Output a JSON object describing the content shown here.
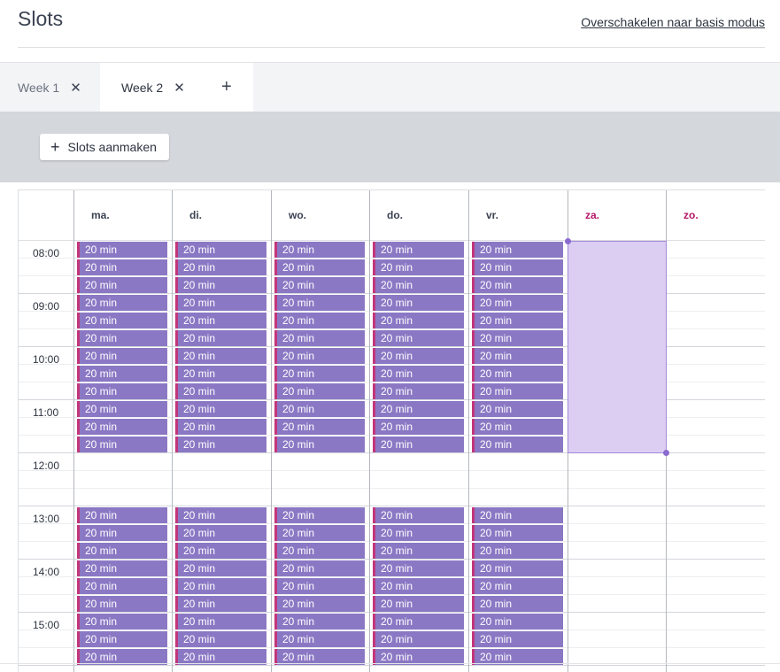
{
  "header": {
    "title": "Slots",
    "mode_link": "Overschakelen naar basis modus"
  },
  "tabs": [
    {
      "label": "Week 1",
      "closable": true,
      "active": false
    },
    {
      "label": "Week 2",
      "closable": true,
      "active": true
    }
  ],
  "tab_add_icon": "plus-icon",
  "toolbar": {
    "create_label": "Slots aanmaken",
    "create_icon": "plus-icon"
  },
  "calendar": {
    "days": [
      {
        "label": "ma.",
        "weekend": false
      },
      {
        "label": "di.",
        "weekend": false
      },
      {
        "label": "wo.",
        "weekend": false
      },
      {
        "label": "do.",
        "weekend": false
      },
      {
        "label": "vr.",
        "weekend": false
      },
      {
        "label": "za.",
        "weekend": true
      },
      {
        "label": "zo.",
        "weekend": true
      }
    ],
    "hours": [
      "08:00",
      "09:00",
      "10:00",
      "11:00",
      "12:00",
      "13:00",
      "14:00",
      "15:00"
    ],
    "slot_label": "20 min",
    "slot_blocks": [
      {
        "days": [
          "ma.",
          "di.",
          "wo.",
          "do.",
          "vr."
        ],
        "start": "08:00",
        "end": "12:00",
        "duration_min": 20
      },
      {
        "days": [
          "ma.",
          "di.",
          "wo.",
          "do.",
          "vr."
        ],
        "start": "13:00",
        "end": "16:00",
        "duration_min": 20
      }
    ],
    "selection": {
      "day": "za.",
      "start": "08:00",
      "end": "12:00"
    }
  },
  "colors": {
    "slot": "#8b78c4",
    "slot_accent": "#c2367a",
    "selection": "#dccdf3",
    "weekend_text": "#b5176a",
    "toolbar_bg": "#d4d7dc"
  }
}
